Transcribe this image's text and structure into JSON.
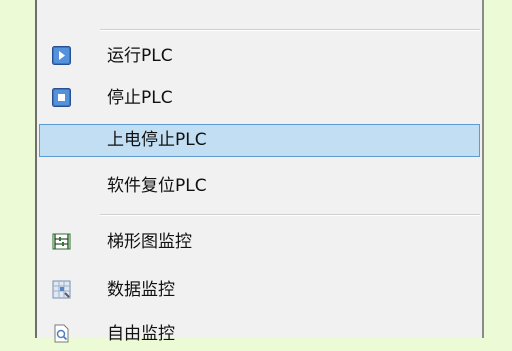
{
  "menu": {
    "items": [
      {
        "label": "运行PLC",
        "icon": "run-icon"
      },
      {
        "label": "停止PLC",
        "icon": "stop-icon"
      },
      {
        "label": "上电停止PLC",
        "icon": ""
      },
      {
        "label": "软件复位PLC",
        "icon": ""
      },
      {
        "label": "梯形图监控",
        "icon": "ladder-monitor-icon"
      },
      {
        "label": "数据监控",
        "icon": "data-monitor-icon"
      },
      {
        "label": "自由监控",
        "icon": "free-monitor-icon"
      }
    ]
  },
  "colors": {
    "background": "#ecfbd6",
    "menu_bg": "#f1f1f1",
    "highlight_bg": "#c2def3",
    "highlight_border": "#5e9bd1",
    "icon_blue": "#3c74c9"
  }
}
